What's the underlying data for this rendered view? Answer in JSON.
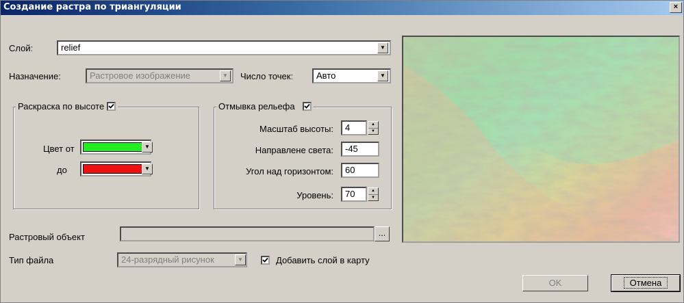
{
  "window": {
    "title": "Создание растра по триангуляции",
    "close_glyph": "×"
  },
  "layer": {
    "label": "Слой:",
    "value": "relief"
  },
  "purpose": {
    "label": "Назначение:",
    "value": "Растровое изображение"
  },
  "points": {
    "label": "Число точек:",
    "value": "Авто"
  },
  "height_coloring": {
    "legend": "Раскраска по высоте",
    "checked": true,
    "from_label": "Цвет от",
    "to_label": "до",
    "from_color": "#22ee22",
    "to_color": "#ee1111"
  },
  "hillshade": {
    "legend": "Отмывка рельефа",
    "checked": true,
    "scale_label": "Масштаб высоты:",
    "scale_value": "4",
    "direction_label": "Направлене света:",
    "direction_value": "-45",
    "angle_label": "Угол над горизонтом:",
    "angle_value": "60",
    "level_label": "Уровень:",
    "level_value": "70"
  },
  "raster_object": {
    "label": "Растровый объект",
    "value": "",
    "browse_label": "..."
  },
  "file_type": {
    "label": "Тип файла",
    "value": "24-разрядный рисунок"
  },
  "add_layer": {
    "label": "Добавить слой в карту",
    "checked": true
  },
  "buttons": {
    "ok": "OK",
    "cancel": "Отмена"
  }
}
